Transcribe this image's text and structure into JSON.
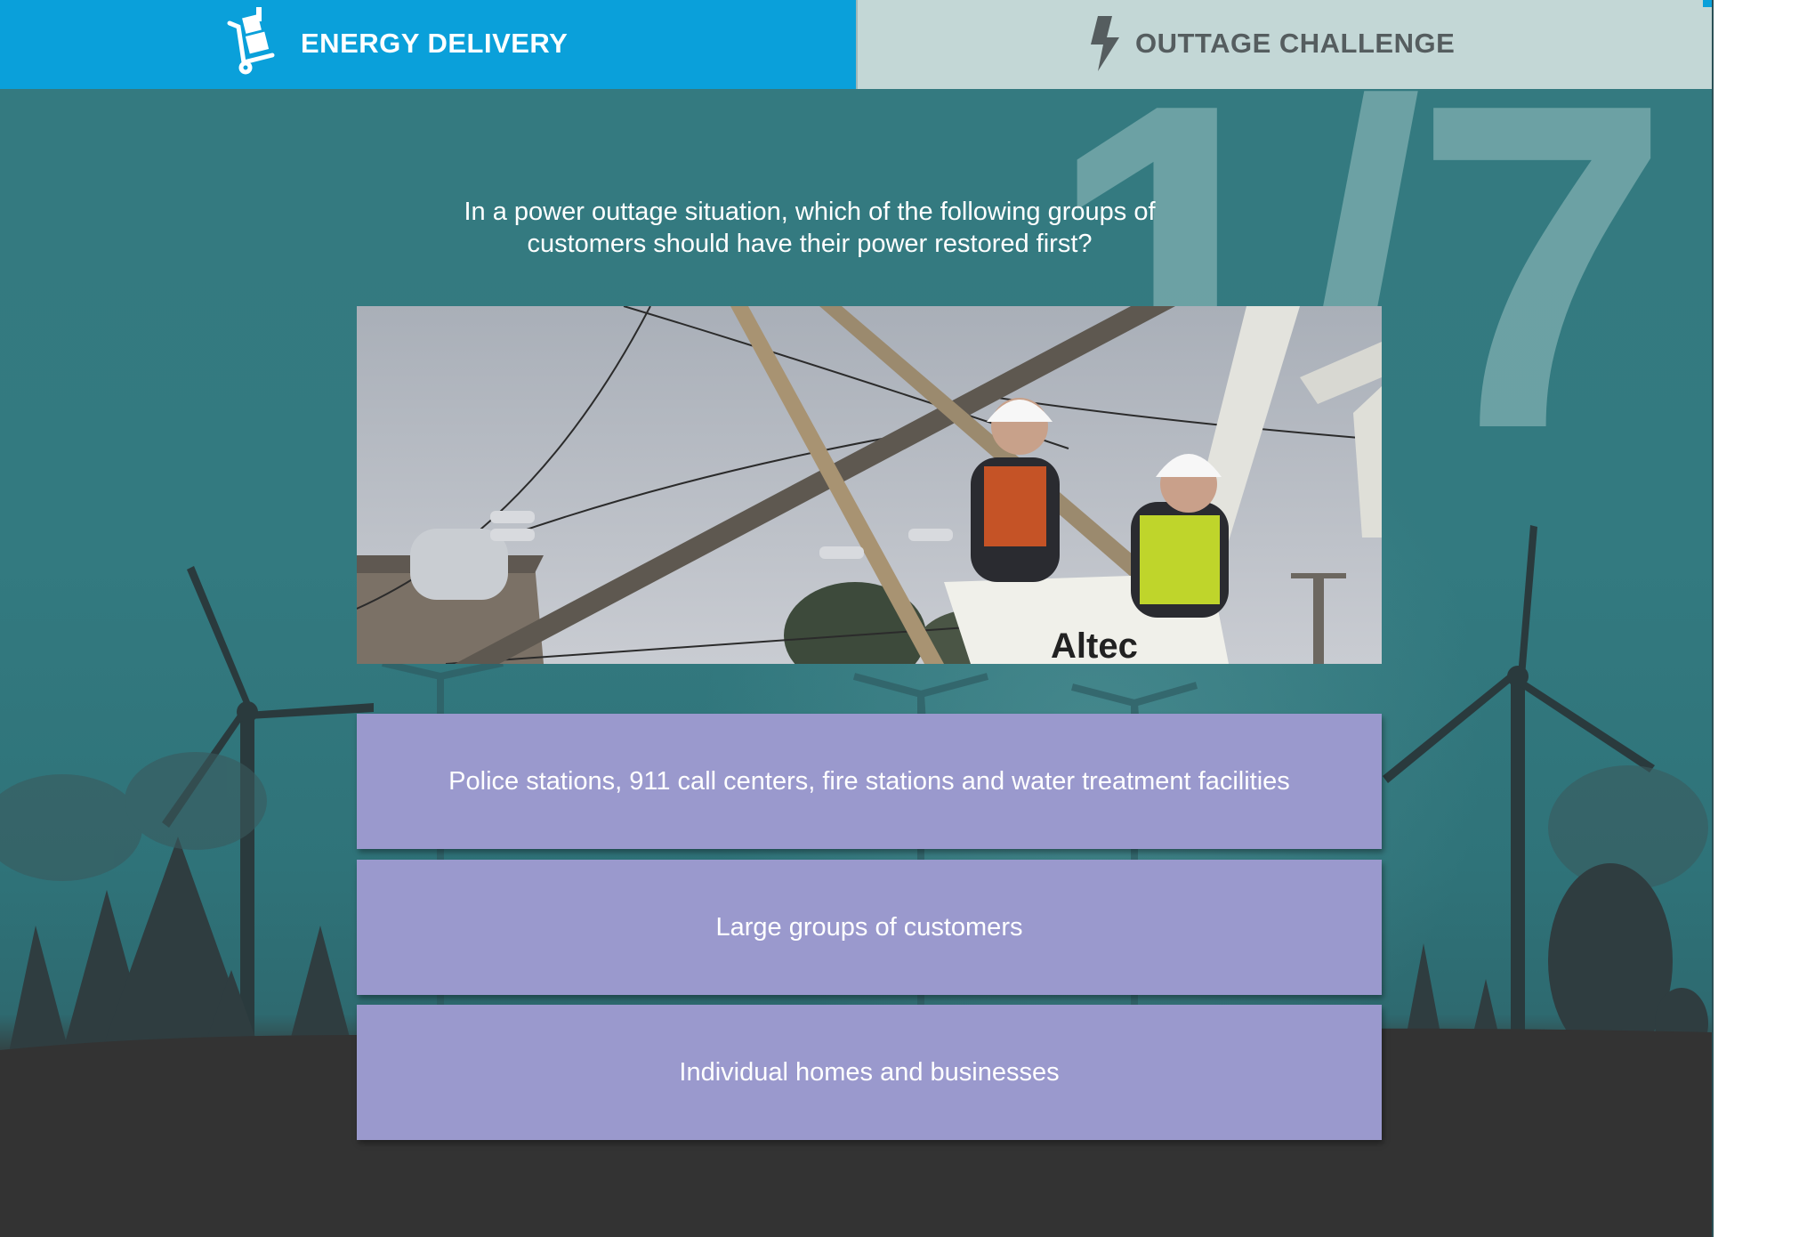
{
  "tabs": [
    {
      "label": "ENERGY DELIVERY",
      "icon": "hand-truck-icon",
      "active": true
    },
    {
      "label": "OUTTAGE CHALLENGE",
      "icon": "lightning-bolt-icon",
      "active": false
    }
  ],
  "progress": {
    "current": "1",
    "separator": "/",
    "total": "7"
  },
  "question": "In a power outtage situation, which of the following groups of customers should have their power restored first?",
  "photo": {
    "bucket_label": "Altec"
  },
  "answers": [
    "Police stations, 911 call centers, fire stations and water treatment facilities",
    "Large groups of customers",
    "Individual homes and businesses"
  ],
  "colors": {
    "active_tab": "#0aa0da",
    "inactive_tab": "#c3d7d6",
    "background_teal": "#337a80",
    "answer_button": "#9a99cd",
    "ground": "#333333"
  }
}
